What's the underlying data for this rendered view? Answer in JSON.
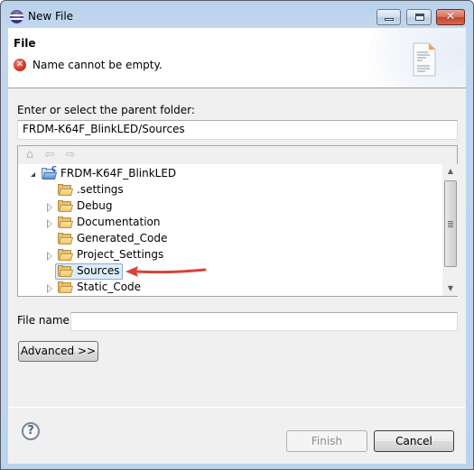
{
  "window": {
    "title": "New File",
    "controls": {
      "minimize": "minimize",
      "maximize": "maximize",
      "close": "✕"
    }
  },
  "banner": {
    "title": "File",
    "error_icon": "✕",
    "message": "Name cannot be empty."
  },
  "parent_folder": {
    "label": "Enter or select the parent folder:",
    "value": "FRDM-K64F_BlinkLED/Sources"
  },
  "tree_toolbar": {
    "home_icon": "⌂",
    "back_icon": "⇦",
    "forward_icon": "⇨"
  },
  "tree": {
    "items": [
      {
        "label": "FRDM-K64F_BlinkLED",
        "type": "project",
        "expanded": true,
        "level": 0
      },
      {
        "label": ".settings",
        "type": "folder",
        "expandable": false,
        "level": 1
      },
      {
        "label": "Debug",
        "type": "folder",
        "expandable": true,
        "level": 1
      },
      {
        "label": "Documentation",
        "type": "folder",
        "expandable": true,
        "level": 1
      },
      {
        "label": "Generated_Code",
        "type": "folder",
        "expandable": false,
        "level": 1
      },
      {
        "label": "Project_Settings",
        "type": "folder",
        "expandable": true,
        "level": 1
      },
      {
        "label": "Sources",
        "type": "folder",
        "expandable": false,
        "level": 1,
        "selected": true
      },
      {
        "label": "Static_Code",
        "type": "folder",
        "expandable": true,
        "level": 1
      }
    ],
    "scroll_up": "▲",
    "scroll_down": "▼"
  },
  "annotation": {
    "arrow_color": "#d9413a",
    "points_to": "Sources"
  },
  "file_name": {
    "label": "File name:",
    "value": "",
    "placeholder": ""
  },
  "buttons": {
    "advanced": "Advanced >>",
    "help_icon": "?",
    "finish": "Finish",
    "finish_enabled": false,
    "cancel": "Cancel"
  }
}
